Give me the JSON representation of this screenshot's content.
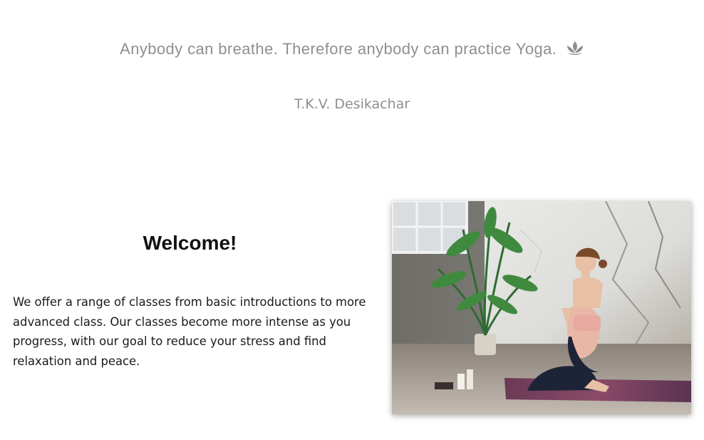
{
  "quote": {
    "text": "Anybody can breathe. Therefore anybody can practice Yoga.",
    "icon": "lotus-icon",
    "author": "T.K.V. Desikachar"
  },
  "welcome": {
    "title": "Welcome!",
    "body": "We offer a range of classes from basic introductions to more advanced class. Our classes become more intense as you progress, with our goal to reduce your stress and find relaxation and peace."
  },
  "colors": {
    "quote_text": "#8f8f8f",
    "heading": "#111111",
    "body_text": "#1a1a1a"
  }
}
